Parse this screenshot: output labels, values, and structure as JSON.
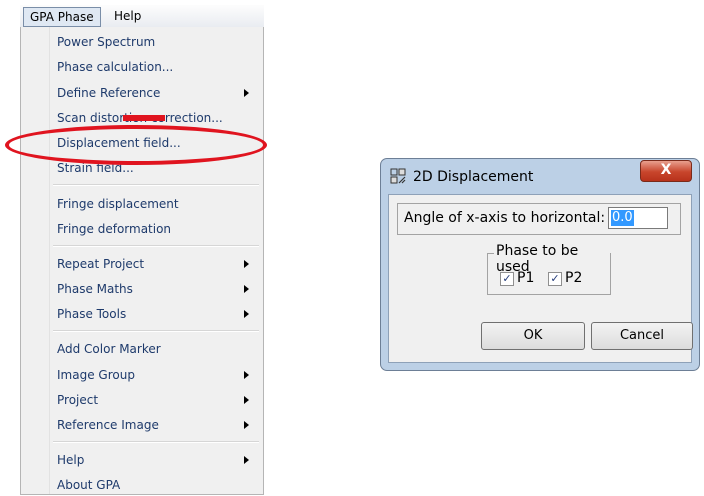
{
  "menubar": {
    "items": [
      {
        "label": "GPA Phase"
      },
      {
        "label": "Help"
      }
    ]
  },
  "menu": {
    "items": [
      {
        "label": "Power Spectrum",
        "submenu": false
      },
      {
        "label": "Phase calculation...",
        "submenu": false
      },
      {
        "label": "Define Reference",
        "submenu": true
      },
      {
        "label": "Scan distortion correction...",
        "submenu": false
      },
      {
        "label": "Displacement field...",
        "submenu": false
      },
      {
        "label": "Strain field...",
        "submenu": false
      },
      {
        "label": "Fringe displacement",
        "submenu": false
      },
      {
        "label": "Fringe deformation",
        "submenu": false
      },
      {
        "label": "Repeat Project",
        "submenu": true
      },
      {
        "label": "Phase Maths",
        "submenu": true
      },
      {
        "label": "Phase Tools",
        "submenu": true
      },
      {
        "label": "Add Color Marker",
        "submenu": false
      },
      {
        "label": "Image Group",
        "submenu": true
      },
      {
        "label": "Project",
        "submenu": true
      },
      {
        "label": "Reference Image",
        "submenu": true
      },
      {
        "label": "Help",
        "submenu": true
      },
      {
        "label": "About GPA",
        "submenu": false
      }
    ]
  },
  "annotation": {
    "highlight_color": "#e0141f",
    "highlighted_item": "Displacement field..."
  },
  "dialog": {
    "title": "2D Displacement",
    "close_glyph": "X",
    "angle_label": "Angle of x-axis to horizontal:",
    "angle_value": "0.0",
    "phase_group_title": "Phase to be used",
    "p1": {
      "label": "P1",
      "checked": true
    },
    "p2": {
      "label": "P2",
      "checked": true
    },
    "ok_label": "OK",
    "cancel_label": "Cancel"
  }
}
